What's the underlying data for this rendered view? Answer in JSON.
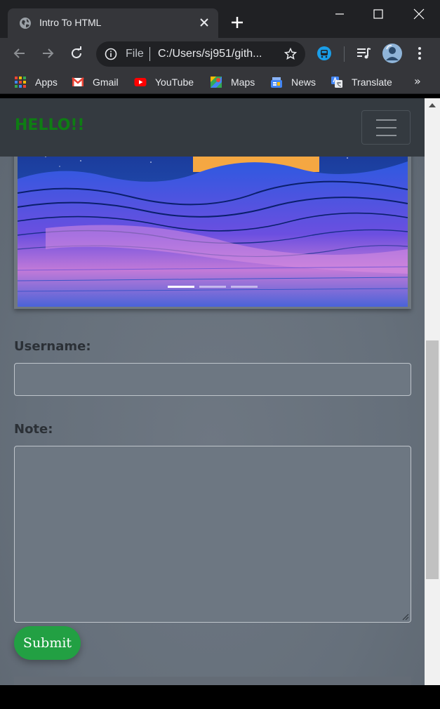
{
  "browser": {
    "tab_title": "Intro To HTML",
    "omnibox": {
      "scheme": "File",
      "url": "C:/Users/sj951/gith..."
    },
    "bookmarks": [
      "Apps",
      "Gmail",
      "YouTube",
      "Maps",
      "News",
      "Translate"
    ],
    "bookmarks_more": "»"
  },
  "page": {
    "brand": "HELLO!!",
    "carousel": {
      "slide_count": 3,
      "active_index": 0
    },
    "form": {
      "username_label": "Username:",
      "username_value": "",
      "note_label": "Note:",
      "note_value": "",
      "submit_label": "Submit"
    }
  },
  "colors": {
    "brand": "#0e7d13",
    "navbar": "#343a40",
    "submit": "#22a043",
    "page_bg": "#6b747f"
  },
  "icons": [
    "globe-icon",
    "close-icon",
    "plus-icon",
    "minimize-icon",
    "maximize-icon",
    "back-icon",
    "forward-icon",
    "reload-icon",
    "info-icon",
    "star-icon",
    "extension-icon",
    "media-icon",
    "profile-avatar",
    "menu-dots-icon",
    "hamburger-icon"
  ]
}
